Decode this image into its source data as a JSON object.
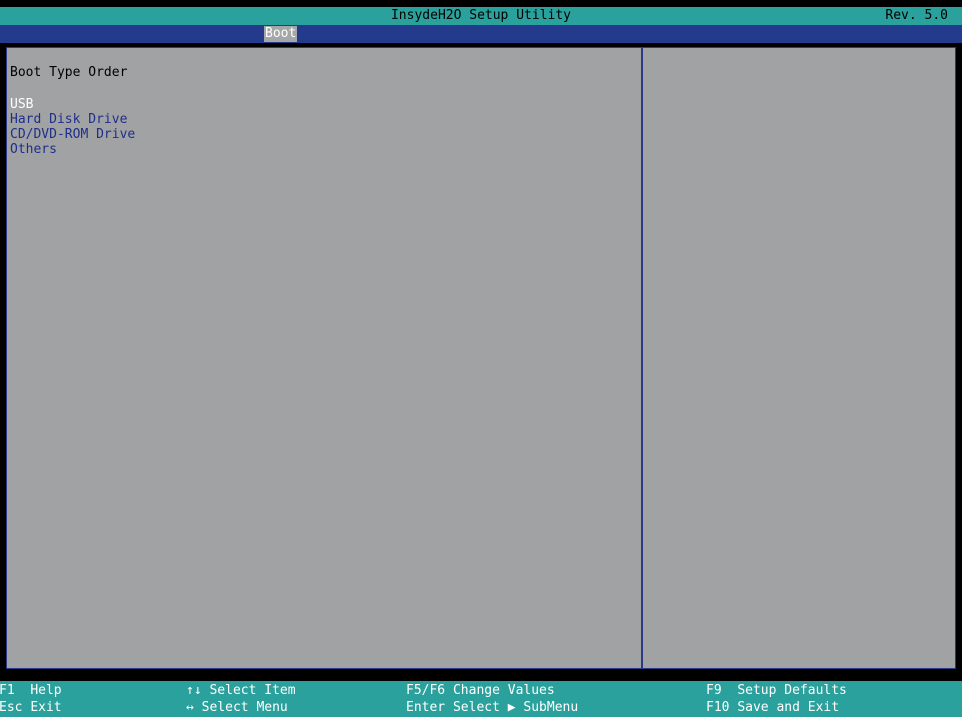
{
  "title_bar": {
    "title": "InsydeH2O Setup Utility",
    "revision": "Rev. 5.0"
  },
  "menu": {
    "active_tab": "Boot"
  },
  "main": {
    "heading": "Boot Type Order",
    "items": [
      {
        "label": "USB",
        "selected": true
      },
      {
        "label": "Hard Disk Drive",
        "selected": false
      },
      {
        "label": "CD/DVD-ROM Drive",
        "selected": false
      },
      {
        "label": "Others",
        "selected": false
      }
    ]
  },
  "help_bar": {
    "f1_key": "F1",
    "f1_desc": "Help",
    "esc_key": "Esc",
    "esc_desc": "Exit",
    "updown_key": "↑↓",
    "updown_desc": "Select Item",
    "leftright_key": "↔",
    "leftright_desc": "Select Menu",
    "f5f6_key": "F5/F6",
    "f5f6_desc": "Change Values",
    "enter_key": "Enter",
    "enter_desc": "Select ▶ SubMenu",
    "f9_key": "F9",
    "f9_desc": "Setup Defaults",
    "f10_key": "F10",
    "f10_desc": "Save and Exit"
  },
  "colors": {
    "title_bar_bg": "#2aa19c",
    "menu_bar_bg": "#243a8c",
    "panel_bg": "#a1a2a4",
    "item_text": "#1e2f8a",
    "selected_text": "#ffffff"
  }
}
